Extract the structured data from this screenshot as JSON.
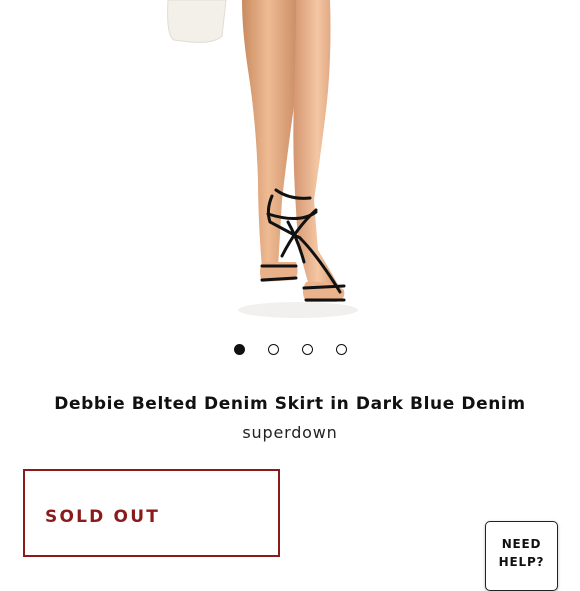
{
  "product": {
    "image": {
      "description": "product-photo-legs-in-strappy-black-sandals",
      "slides_total": 4,
      "active_slide": 1
    },
    "title": "Debbie Belted Denim Skirt in Dark Blue Denim",
    "brand": "superdown"
  },
  "actions": {
    "sold_out_label": "SOLD OUT"
  },
  "help": {
    "line1": "NEED",
    "line2": "HELP?"
  },
  "colors": {
    "accent": "#8b1a1a",
    "text": "#111111",
    "background": "#ffffff"
  }
}
